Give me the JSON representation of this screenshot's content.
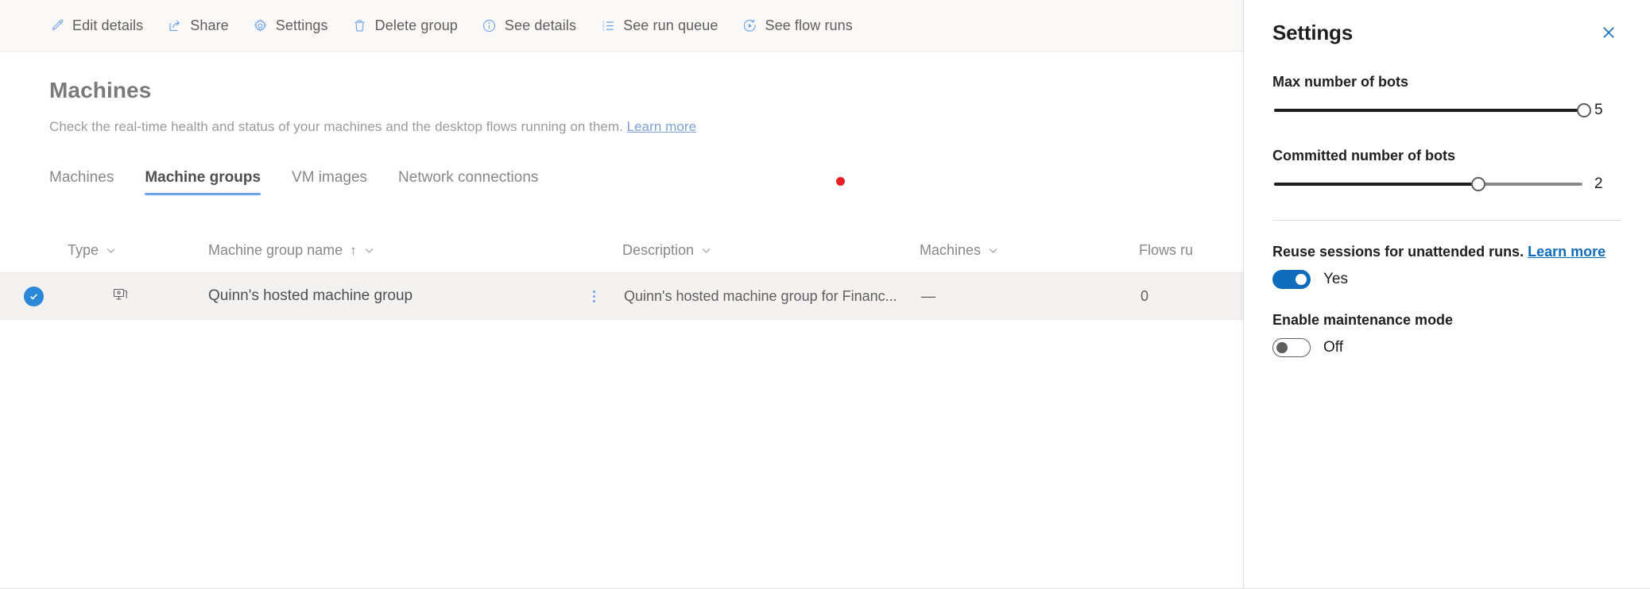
{
  "command_bar": {
    "items": [
      {
        "label": "Edit details",
        "icon": "pencil-icon"
      },
      {
        "label": "Share",
        "icon": "share-icon"
      },
      {
        "label": "Settings",
        "icon": "gear-icon"
      },
      {
        "label": "Delete group",
        "icon": "trash-icon"
      },
      {
        "label": "See details",
        "icon": "info-icon"
      },
      {
        "label": "See run queue",
        "icon": "list-numbered-icon"
      },
      {
        "label": "See flow runs",
        "icon": "play-circle-icon"
      }
    ]
  },
  "page": {
    "title": "Machines",
    "subtitle": "Check the real-time health and status of your machines and the desktop flows running on them.",
    "learn_more": "Learn more"
  },
  "tabs": [
    {
      "label": "Machines",
      "active": false
    },
    {
      "label": "Machine groups",
      "active": true
    },
    {
      "label": "VM images",
      "active": false
    },
    {
      "label": "Network connections",
      "active": false
    }
  ],
  "table": {
    "columns": [
      {
        "label": "Type",
        "sorted": false
      },
      {
        "label": "Machine group name",
        "sorted": true,
        "sort_glyph": "↑"
      },
      {
        "label": "Description",
        "sorted": false
      },
      {
        "label": "Machines",
        "sorted": false
      },
      {
        "label": "Flows ru",
        "sorted": false
      }
    ],
    "rows": [
      {
        "selected": true,
        "type_icon": "machine-group-icon",
        "name": "Quinn's hosted machine group",
        "description": "Quinn's hosted machine group for Financ...",
        "machines": "—",
        "flows_running": "0"
      }
    ]
  },
  "panel": {
    "title": "Settings",
    "close_icon": "close-icon",
    "max_bots": {
      "label": "Max number of bots",
      "value": "5",
      "percent": 100
    },
    "committed_bots": {
      "label": "Committed number of bots",
      "value": "2",
      "percent": 66
    },
    "reuse_sessions": {
      "label": "Reuse sessions for unattended runs.",
      "learn_more": "Learn more",
      "state": "Yes",
      "on": true
    },
    "maintenance_mode": {
      "label": "Enable maintenance mode",
      "state": "Off",
      "on": false
    }
  },
  "colors": {
    "accent_blue": "#0f6cbd",
    "icon_blue": "#6ba3ef",
    "tab_underline": "#6ba3ef",
    "notification_red": "#e81f25",
    "row_selected_bg": "#f3f2f1"
  }
}
